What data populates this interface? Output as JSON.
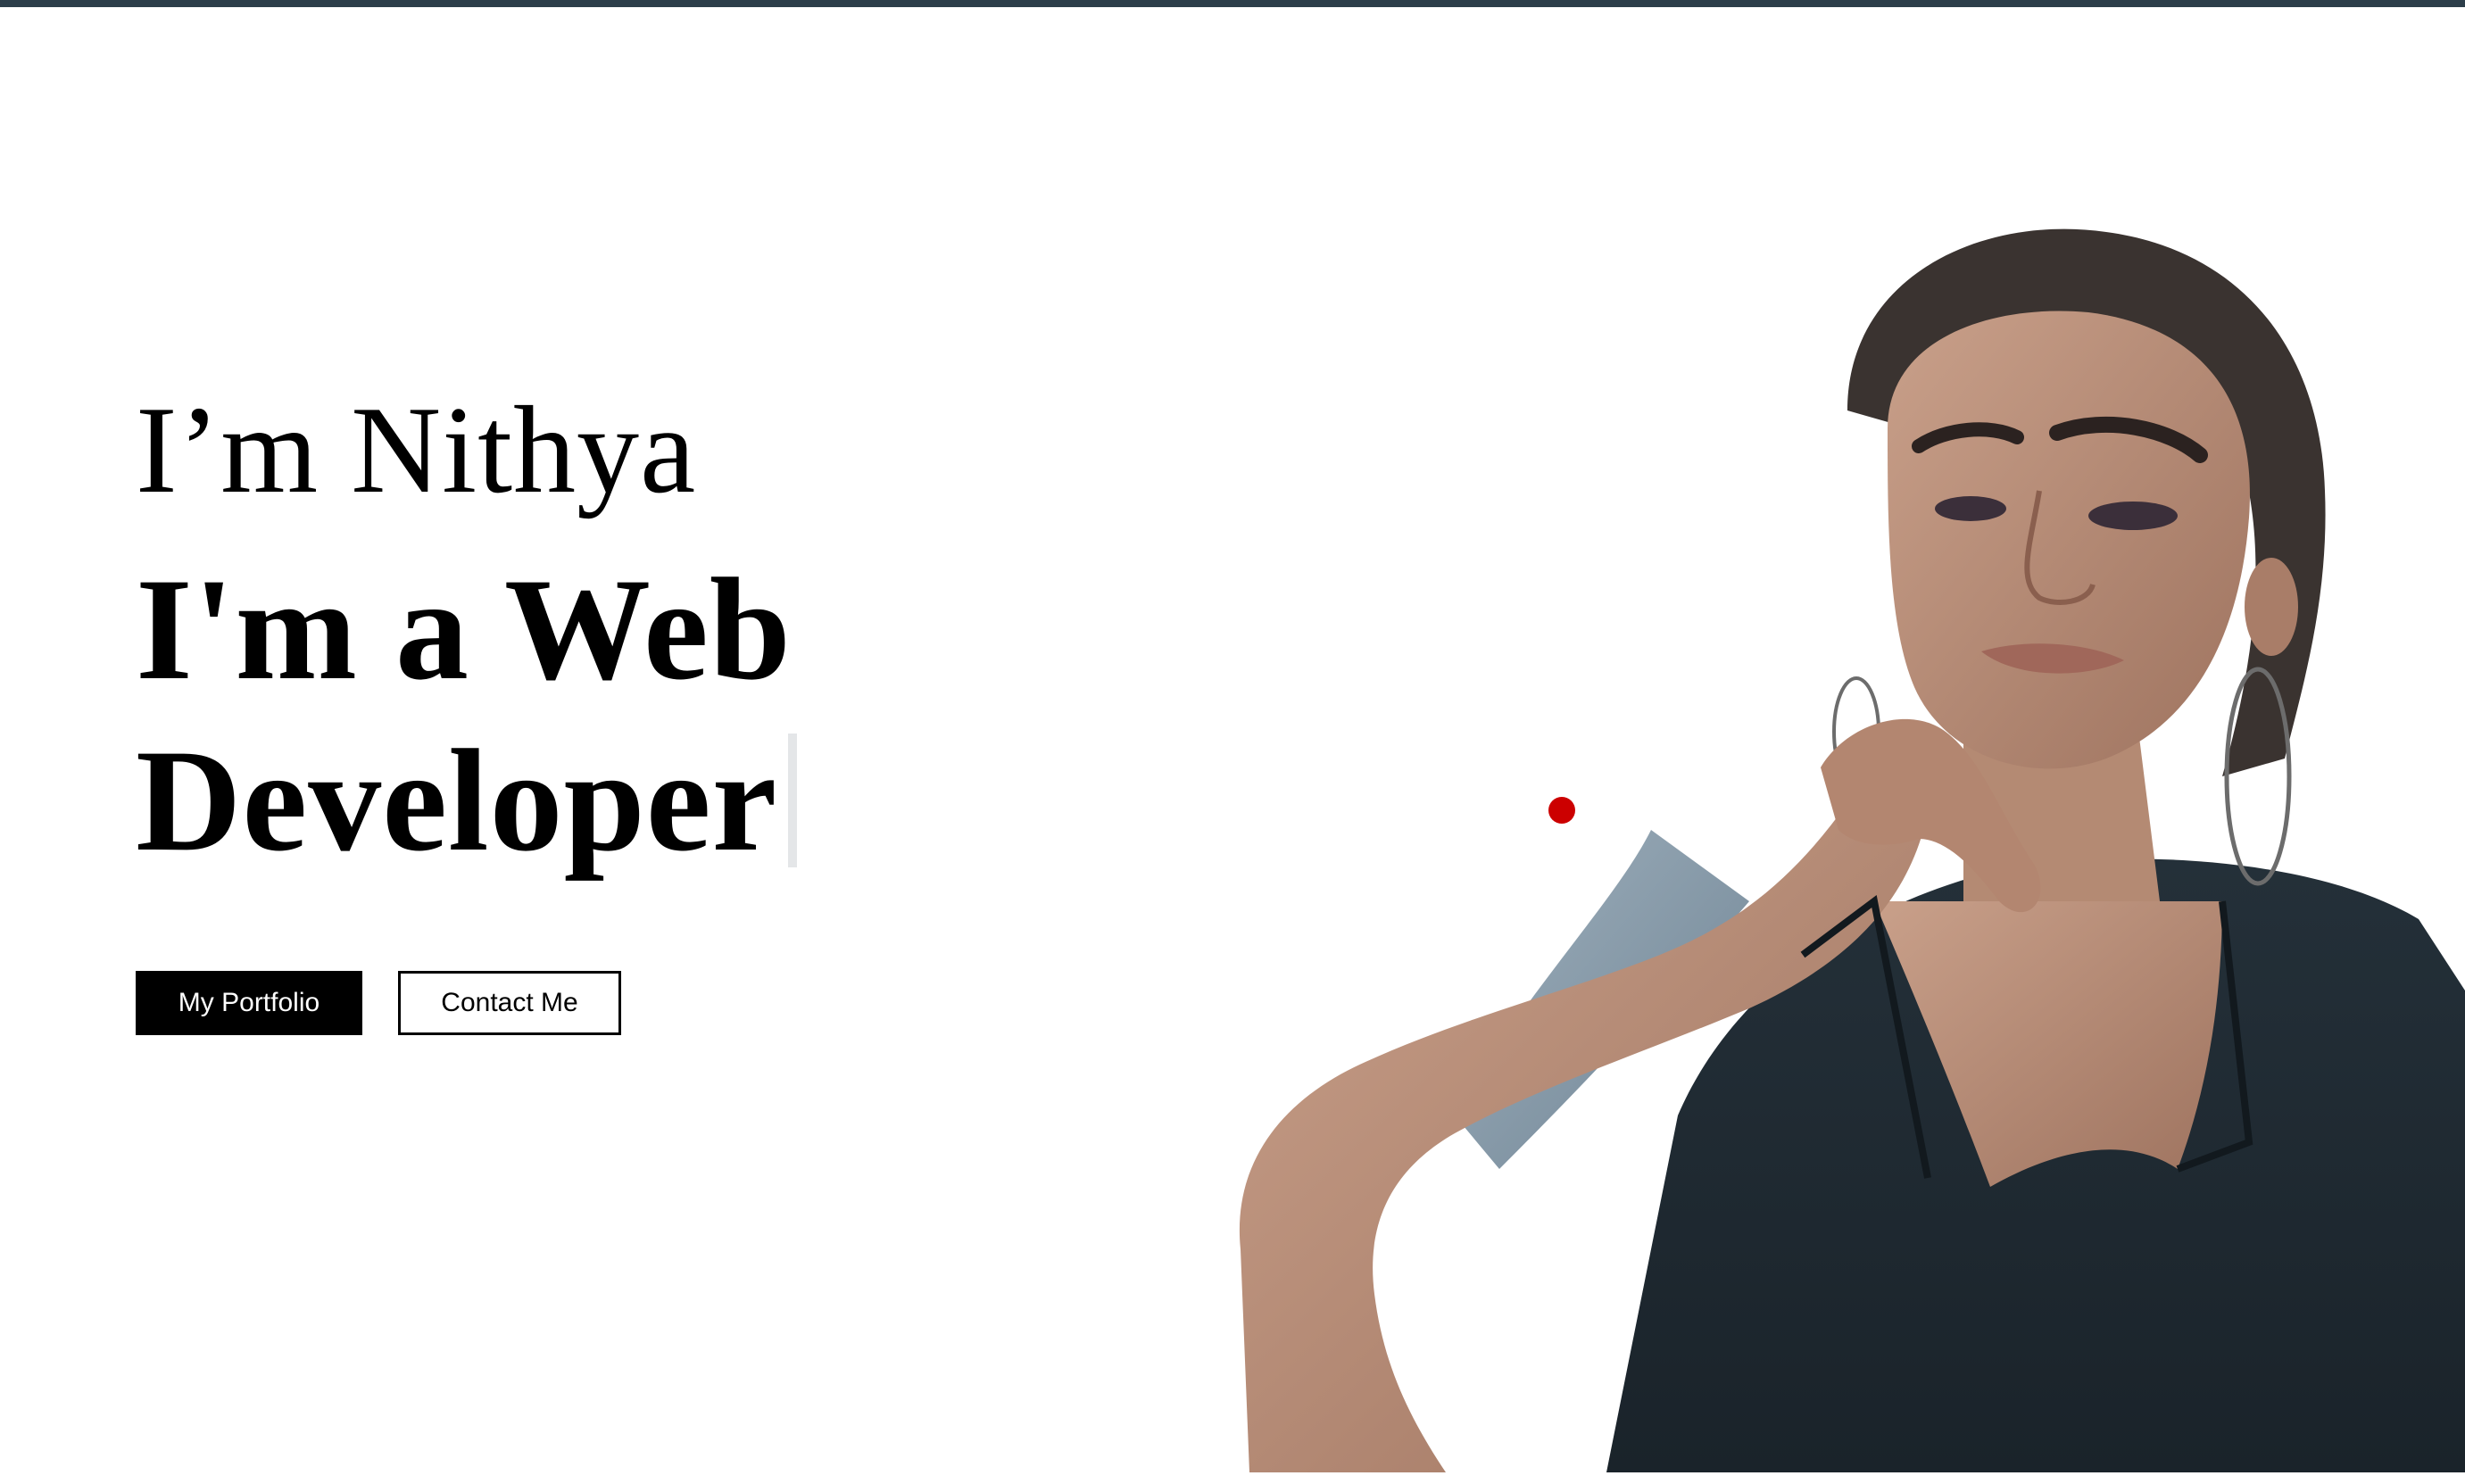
{
  "hero": {
    "greeting": "I’m Nithya",
    "role": "I'm a Web Developer"
  },
  "buttons": {
    "portfolio_label": "My Portfolio",
    "contact_label": "Contact Me"
  },
  "colors": {
    "top_bar": "#2c3e4a",
    "accent": "#cc0000",
    "primary_button": "#000000",
    "background": "#ffffff"
  },
  "images": {
    "portrait": "illustrated-portrait"
  }
}
